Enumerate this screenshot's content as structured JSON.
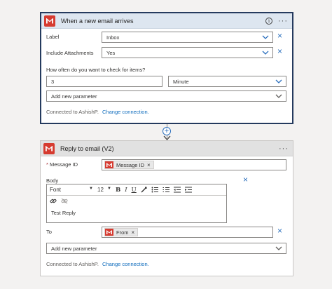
{
  "trigger_card": {
    "title": "When a new email arrives",
    "label_label": "Label",
    "label_value": "Inbox",
    "attachments_label": "Include Attachments",
    "attachments_value": "Yes",
    "frequency_question": "How often do you want to check for items?",
    "interval_value": "3",
    "frequency_value": "Minute",
    "add_param": "Add new parameter",
    "connected_text": "Connected to AshishP.",
    "change_connection": "Change connection."
  },
  "reply_card": {
    "title": "Reply to email (V2)",
    "required_mark": "*",
    "message_id_label": "Message ID",
    "message_id_token": "Message ID",
    "body_label": "Body",
    "font_label": "Font",
    "font_size": "12",
    "body_text": "Test Reply",
    "to_label": "To",
    "to_token": "From",
    "add_param": "Add new parameter",
    "connected_text": "Connected to AshishP.",
    "change_connection": "Change connection."
  },
  "icons": {
    "close": "×",
    "more": "···",
    "info": "i",
    "plus": "+",
    "down_arrow": "▼"
  },
  "colors": {
    "accent": "#0f6cbd",
    "gmail_red": "#d63b30",
    "selected_border": "#243a5e"
  }
}
